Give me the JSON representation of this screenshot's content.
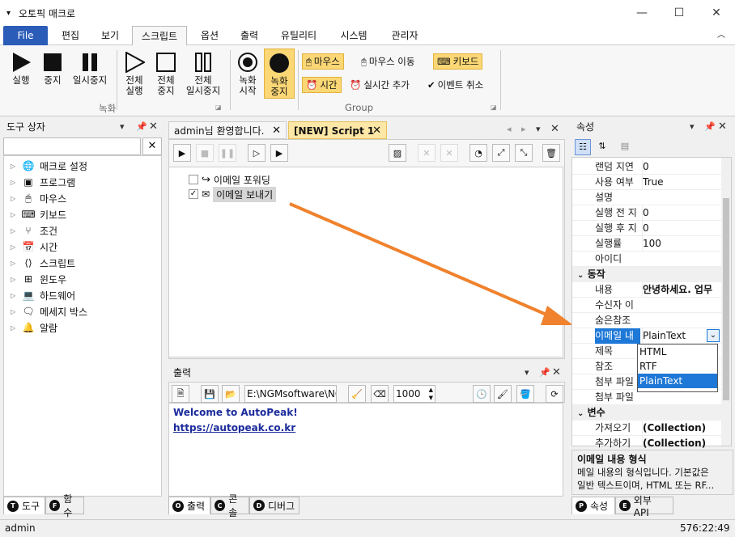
{
  "app": {
    "title": "오토픽 매크로"
  },
  "menu": [
    "File",
    "편집",
    "보기",
    "스크립트",
    "옵션",
    "출력",
    "유틸리티",
    "시스템",
    "관리자"
  ],
  "ribbon": {
    "run": "실행",
    "stop": "중지",
    "pause": "일시중지",
    "run_all": [
      "전체",
      "실행"
    ],
    "stop_all": [
      "전체",
      "중지"
    ],
    "pause_all": [
      "전체",
      "일시중지"
    ],
    "record_start": [
      "녹화",
      "시작"
    ],
    "record_stop": [
      "녹화",
      "중지"
    ],
    "mouse": "마우스",
    "mouse_move": "마우스 이동",
    "keyboard": "키보드",
    "time": "시간",
    "realtime_add": "실시간 추가",
    "event_cancel": "이벤트 취소",
    "group_record": "녹화",
    "group_group": "Group"
  },
  "toolbox": {
    "title": "도구 상자",
    "items": [
      "매크로 설정",
      "프로그램",
      "마우스",
      "키보드",
      "조건",
      "시간",
      "스크립트",
      "윈도우",
      "하드웨어",
      "메세지 박스",
      "알람"
    ],
    "tabs": [
      "도구",
      "함수"
    ],
    "tab_letters": [
      "T",
      "F"
    ]
  },
  "doc": {
    "tabs": [
      "admin님 환영합니다.",
      "[NEW] Script 1"
    ],
    "actions": [
      {
        "label": "이메일 포워딩",
        "checked": false
      },
      {
        "label": "이메일 보내기",
        "checked": true
      }
    ]
  },
  "output": {
    "title": "출력",
    "path": "E:\\NGMsoftware\\NG",
    "number": "1000",
    "line1": "Welcome to AutoPeak!",
    "line2": "https://autopeak.co.kr",
    "tabs": [
      "출력",
      "콘솔",
      "디버그"
    ],
    "tab_letters": [
      "O",
      "C",
      "D"
    ]
  },
  "properties": {
    "title": "속성",
    "rows1": [
      {
        "k": "랜덤 지연",
        "v": "0"
      },
      {
        "k": "사용 여부",
        "v": "True"
      },
      {
        "k": "설명",
        "v": ""
      },
      {
        "k": "실행 전 지",
        "v": "0"
      },
      {
        "k": "실행 후 지",
        "v": "0"
      },
      {
        "k": "실행률",
        "v": "100"
      },
      {
        "k": "아이디",
        "v": ""
      }
    ],
    "cat_action": "동작",
    "rows2": [
      {
        "k": "내용",
        "v": "안녕하세요. 업무"
      },
      {
        "k": "수신자 이",
        "v": ""
      },
      {
        "k": "숨은참조",
        "v": ""
      },
      {
        "k": "이메일 내",
        "v": "PlainText"
      },
      {
        "k": "제목",
        "v": ""
      },
      {
        "k": "참조",
        "v": ""
      },
      {
        "k": "첨부 파일",
        "v": ""
      },
      {
        "k": "첨부 파일",
        "v": ""
      }
    ],
    "cat_var": "변수",
    "rows3": [
      {
        "k": "가져오기",
        "v": "(Collection)"
      },
      {
        "k": "추가하기",
        "v": "(Collection)"
      }
    ],
    "dropdown": [
      "HTML",
      "RTF",
      "PlainText"
    ],
    "desc_title": "이메일 내용 형식",
    "desc_text": [
      "메일 내용의 형식입니다. 기본값은",
      "일반 텍스트이며, HTML 또는 RF..."
    ],
    "tabs": [
      "속성",
      "외부 API"
    ],
    "tab_letters": [
      "P",
      "E"
    ]
  },
  "status": {
    "user": "admin",
    "time": "576:22:49"
  }
}
